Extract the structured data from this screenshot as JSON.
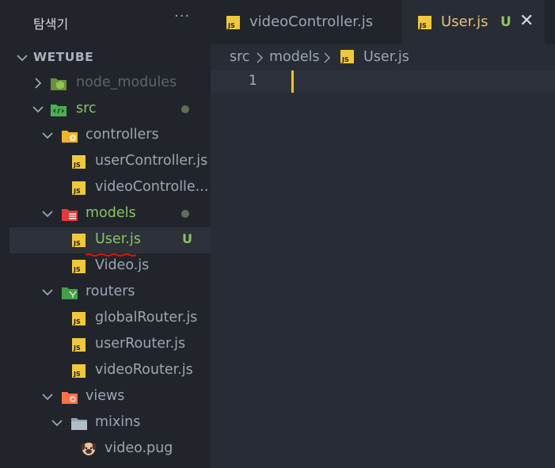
{
  "sidebar": {
    "title": "탐색기",
    "more": "···",
    "root": {
      "label": "WETUBE"
    },
    "items": [
      {
        "label": "node_modules"
      },
      {
        "label": "src"
      },
      {
        "label": "controllers"
      },
      {
        "label": "userController.js",
        "badge": "JS"
      },
      {
        "label": "videoControlle...",
        "badge": "JS"
      },
      {
        "label": "models"
      },
      {
        "label": "User.js",
        "badge": "JS",
        "status": "U"
      },
      {
        "label": "Video.js",
        "badge": "JS"
      },
      {
        "label": "routers"
      },
      {
        "label": "globalRouter.js",
        "badge": "JS"
      },
      {
        "label": "userRouter.js",
        "badge": "JS"
      },
      {
        "label": "videoRouter.js",
        "badge": "JS"
      },
      {
        "label": "views"
      },
      {
        "label": "mixins"
      },
      {
        "label": "video.pug"
      }
    ]
  },
  "tabs": [
    {
      "label": "videoController.js",
      "badge": "JS"
    },
    {
      "label": "User.js",
      "badge": "JS",
      "status": "U",
      "close": "✕"
    }
  ],
  "breadcrumb": [
    "src",
    "models",
    "User.js"
  ],
  "breadcrumb_sep": "›",
  "editor": {
    "line_numbers": [
      "1"
    ]
  },
  "colors": {
    "accent_js": "#f0c93b",
    "untracked_green": "#8cc265",
    "cursor": "#f5c518",
    "error_squiggle": "#e51400"
  },
  "icons": {
    "folder_node": "nodejs-folder-icon",
    "folder_src": "src-folder-icon",
    "folder_controllers": "controllers-folder-icon",
    "folder_models": "models-folder-icon",
    "folder_routers": "routers-folder-icon",
    "folder_views": "views-folder-icon",
    "folder_mixins": "folder-icon",
    "pug": "pug-icon",
    "js": "js-file-icon"
  }
}
